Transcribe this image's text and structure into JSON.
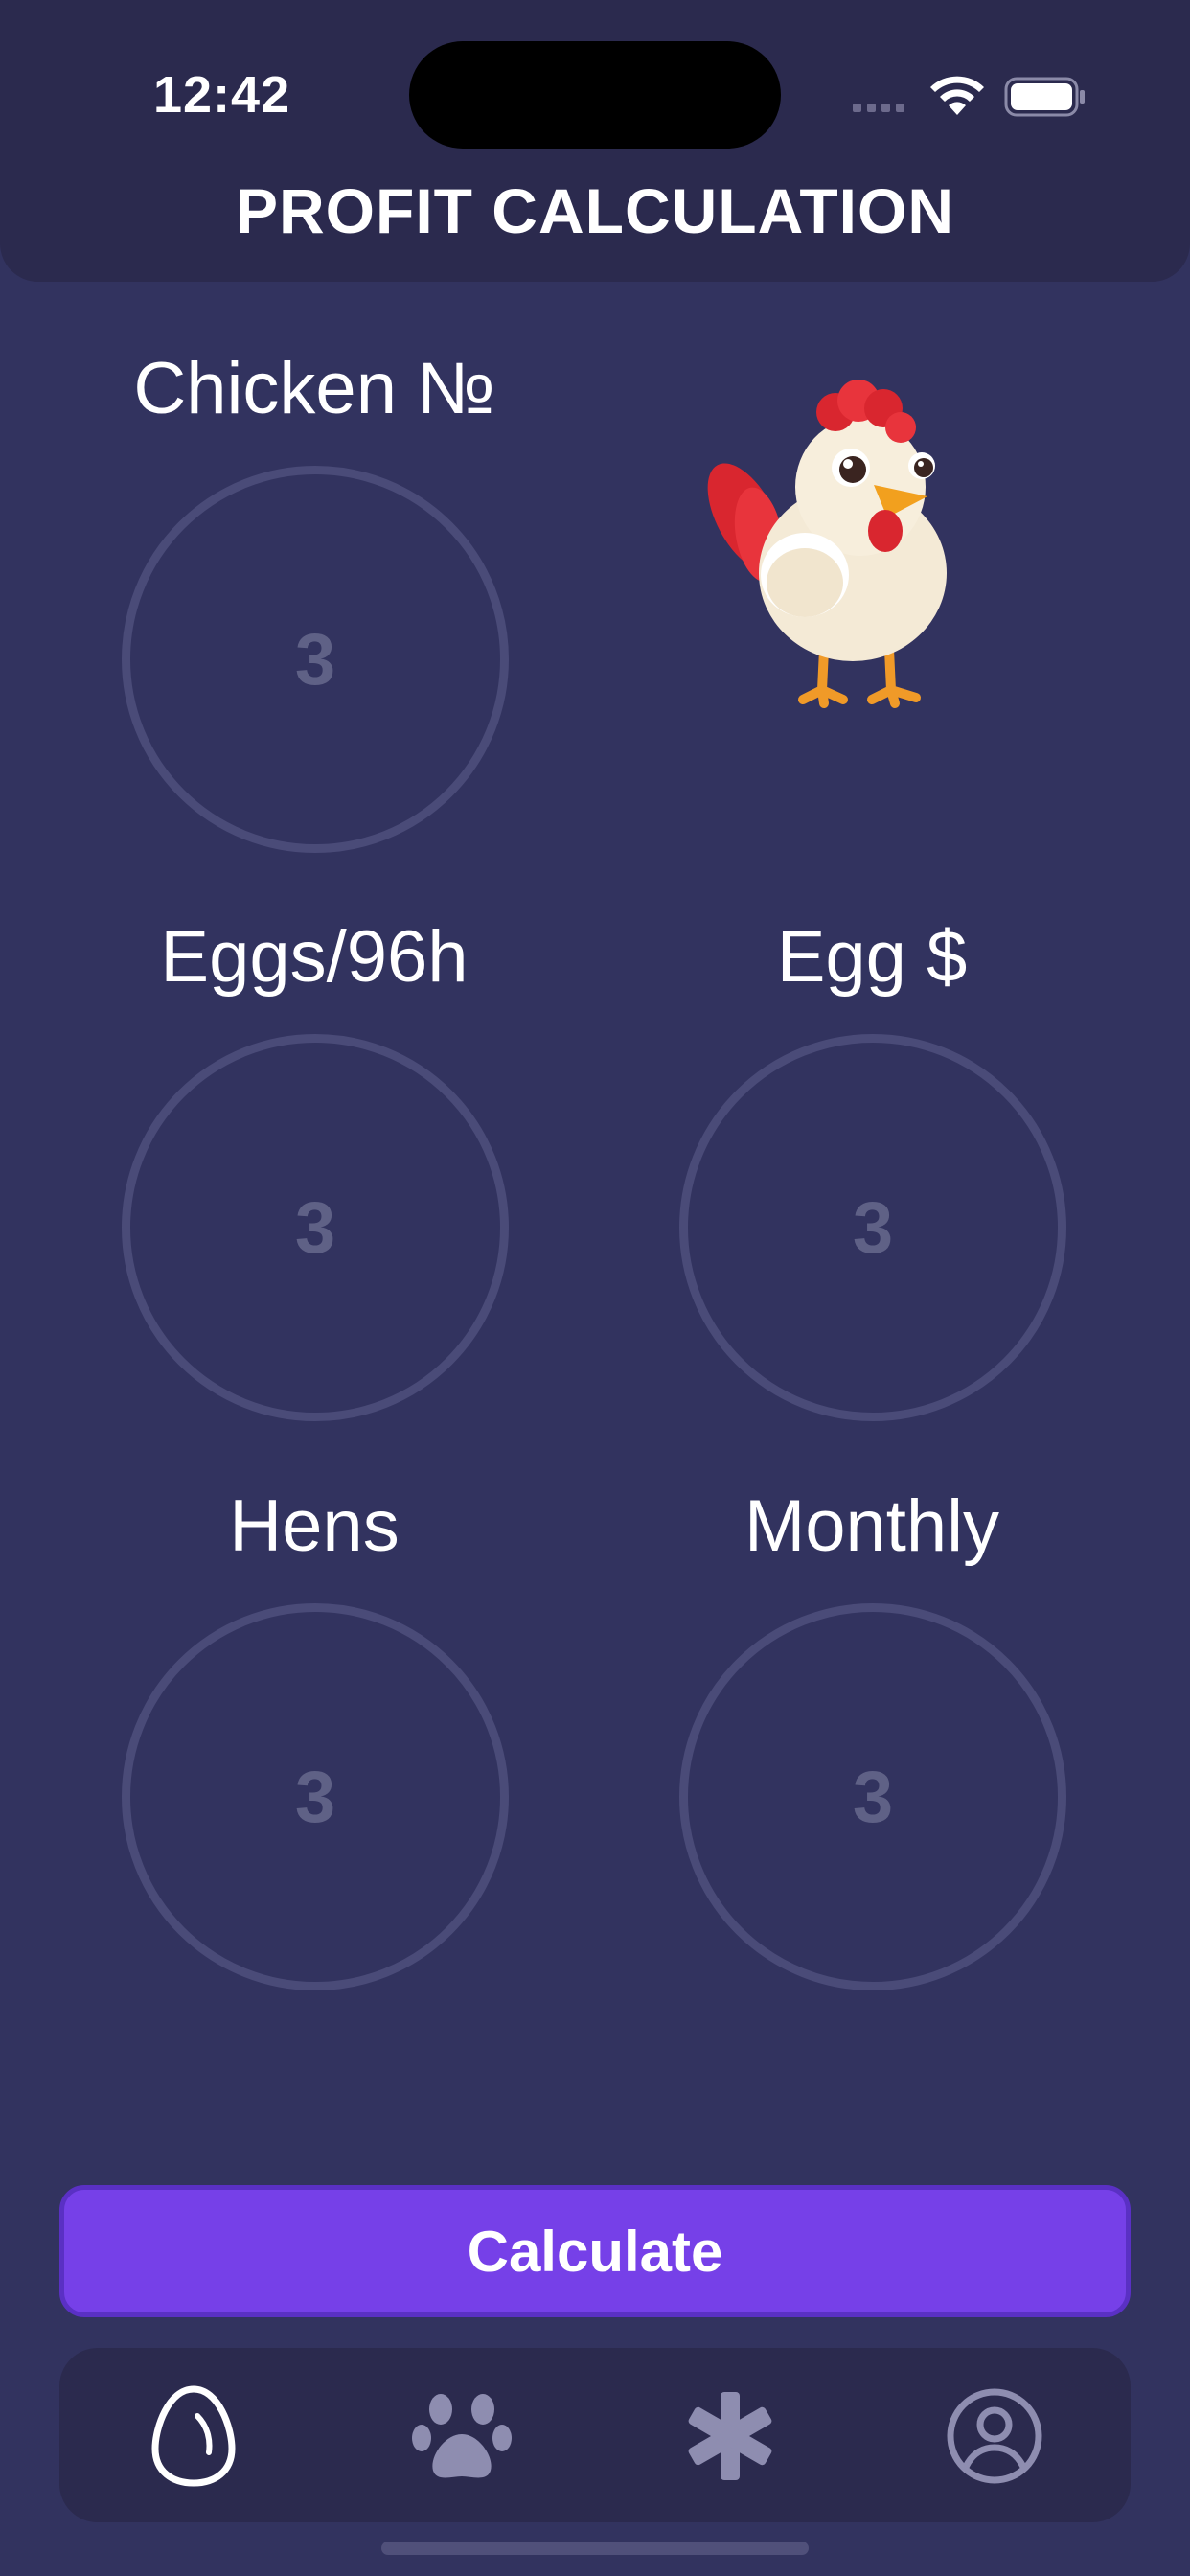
{
  "status_bar": {
    "time": "12:42"
  },
  "header": {
    "title": "PROFIT CALCULATION"
  },
  "fields": {
    "chicken_no": {
      "label": "Chicken №",
      "placeholder": "3"
    },
    "eggs_96h": {
      "label": "Eggs/96h",
      "placeholder": "3"
    },
    "egg_price": {
      "label": "Egg $",
      "placeholder": "3"
    },
    "hens": {
      "label": "Hens",
      "placeholder": "3"
    },
    "monthly": {
      "label": "Monthly",
      "placeholder": "3"
    }
  },
  "illustration": {
    "icon": "chicken-illustration"
  },
  "calculate_button": {
    "label": "Calculate"
  },
  "tab_bar": {
    "tabs": [
      {
        "icon": "egg-icon",
        "active": true
      },
      {
        "icon": "paw-icon",
        "active": false
      },
      {
        "icon": "asterisk-icon",
        "active": false
      },
      {
        "icon": "profile-icon",
        "active": false
      }
    ]
  },
  "colors": {
    "background": "#32335f",
    "header": "#2b2a4e",
    "accent": "#7640e8",
    "circle_border": "#4a4b78",
    "placeholder": "#5f6186",
    "inactive_icon": "#8e8db0"
  }
}
